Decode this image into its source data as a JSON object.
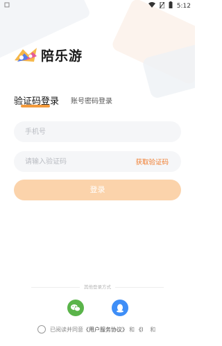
{
  "status_bar": {
    "left_icon": "notification-icon",
    "time": "5:12"
  },
  "brand": {
    "name": "陪乐游"
  },
  "tabs": [
    {
      "label": "验证码登录",
      "active": true
    },
    {
      "label": "账号密码登录",
      "active": false
    }
  ],
  "form": {
    "phone_placeholder": "手机号",
    "code_placeholder": "请输入验证码",
    "get_code_label": "获取验证码",
    "login_label": "登录"
  },
  "other_login": {
    "label": "其他登录方式",
    "methods": [
      "wechat-icon",
      "qq-icon"
    ]
  },
  "agreement": {
    "prefix": "已阅读并同意",
    "link": "《用户服务协议》",
    "connector": "和",
    "trailing": "《l",
    "extra": "和"
  },
  "colors": {
    "accent": "#f07a2a",
    "button": "#fbd3ab",
    "underline": "#f39a3c",
    "wechat": "#5ab44a",
    "qq": "#3e8ef7"
  }
}
